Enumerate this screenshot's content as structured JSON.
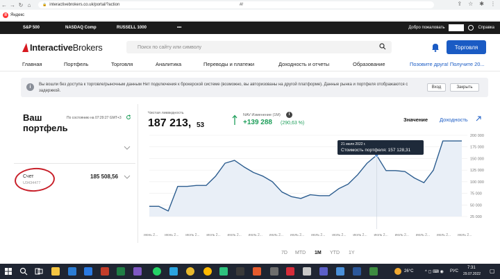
{
  "browser": {
    "url": "interactivebrokers.co.uk/portal/?action",
    "url_hash": "#/",
    "bookmark": "Яндекс"
  },
  "ticker": {
    "items": [
      "S&P 500",
      "NASDAQ Comp",
      "RUSSELL 1000",
      "•••"
    ],
    "welcome": "Добро пожаловать",
    "help": "Справка"
  },
  "header": {
    "logo_bold": "Interactive",
    "logo_regular": "Brokers",
    "search_placeholder": "Поиск по сайту или символу",
    "trade_button": "Торговля"
  },
  "nav": {
    "items": [
      "Главная",
      "Портфель",
      "Торговля",
      "Аналитика",
      "Переводы и платежи",
      "Доходность и отчеты",
      "Образование"
    ],
    "promo": "Позовите друга! Получите 20..."
  },
  "notice": {
    "text": "Вы вошли без доступа к торговле/рыночным данным Нет подключения к брокерской системе (возможно, вы авторизованы на другой платформе). Данные рынка и портфеля отображаются с задержкой.",
    "login_button": "Вход",
    "close_button": "Закрыть"
  },
  "portfolio": {
    "title_line1": "Ваш",
    "title_line2": "портфель",
    "as_of": "По состоянию на 07:29:27 GMT+3",
    "account_label": "Счет",
    "account_number": "U3434477",
    "account_value": "185 508,56"
  },
  "summary": {
    "liquidity_label": "Чистая ликвидность",
    "liquidity_int": "187 213,",
    "liquidity_dec": "53",
    "nav_label": "NAV Изменение (1M)",
    "nav_change": "+139 288",
    "nav_pct": "(290,63 %)",
    "toggle_value": "Значение",
    "toggle_return": "Доходность"
  },
  "tooltip": {
    "date": "21 июля 2022 г.",
    "value": "Стоимость портфеля: 157 128,31"
  },
  "periods": [
    "7D",
    "MTD",
    "1M",
    "YTD",
    "1Y"
  ],
  "periods_active": "1M",
  "chart_data": {
    "type": "area",
    "y_ticks": [
      "200 000",
      "175 000",
      "150 000",
      "125 000",
      "100 000",
      "75 000",
      "50 000",
      "25 000"
    ],
    "x_ticks": [
      "июнь 2...",
      "июнь 2...",
      "июль 2...",
      "июль 2...",
      "июль 2...",
      "июль 2...",
      "июль 2...",
      "июль 2...",
      "июль 2...",
      "июль 2...",
      "июль 2...",
      "июль 2...",
      "июль 2...",
      "июль 2...",
      "июль 2...",
      "июль 2..."
    ],
    "ylim": [
      25000,
      200000
    ],
    "series": [
      {
        "values": [
          47000,
          47000,
          37000,
          90000,
          90000,
          92000,
          92000,
          112000,
          140000,
          146000,
          132000,
          120000,
          112000,
          100000,
          78000,
          68000,
          64000,
          72000,
          70000,
          70000,
          85000,
          95000,
          115000,
          140000,
          157128,
          124000,
          124000,
          122000,
          108000,
          98000,
          125000,
          188000,
          188000,
          188000
        ]
      }
    ],
    "highlight_index": 24,
    "colors": {
      "line": "#2c5d8f",
      "fill": "#e9eff7",
      "tooltip": "#1e2a3a"
    }
  },
  "taskbar": {
    "weather": "26°C",
    "lang": "РУС",
    "time": "7:31",
    "date": "29.07.2022"
  }
}
